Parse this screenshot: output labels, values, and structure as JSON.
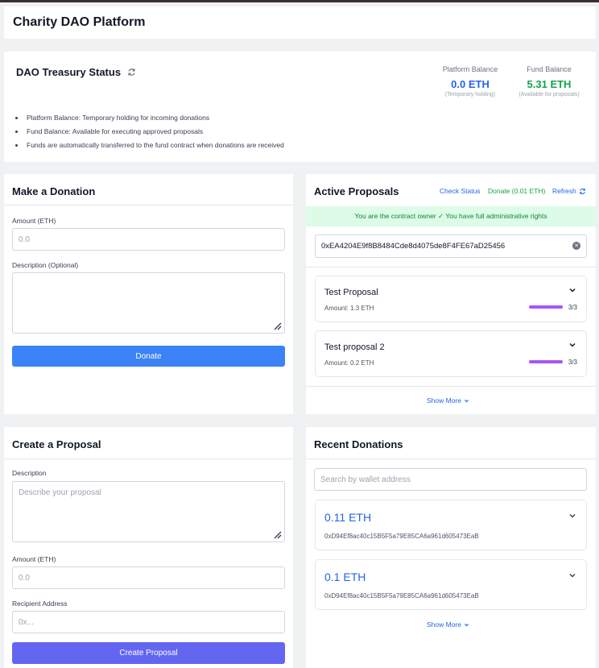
{
  "app": {
    "title": "Charity DAO Platform"
  },
  "treasury": {
    "title": "DAO Treasury Status",
    "platform": {
      "label": "Platform Balance",
      "value": "0.0 ETH",
      "note": "(Temporary holding)"
    },
    "fund": {
      "label": "Fund Balance",
      "value": "5.31 ETH",
      "note": "(Available for proposals)"
    },
    "bullets": [
      "Platform Balance: Temporary holding for incoming donations",
      "Fund Balance: Available for executing approved proposals",
      "Funds are automatically transferred to the fund contract when donations are received"
    ],
    "colors": {
      "platform": "#2563eb",
      "fund": "#16a34a"
    }
  },
  "donation": {
    "title": "Make a Donation",
    "amount_label": "Amount (ETH)",
    "amount_placeholder": "0.0",
    "description_label": "Description (Optional)",
    "button": "Donate",
    "button_color": "#3b82f6"
  },
  "proposals": {
    "title": "Active Proposals",
    "links": {
      "check": "Check Status",
      "donate": "Donate (0.01 ETH)",
      "refresh": "Refresh"
    },
    "owner_message": "You are the contract owner ✓ You have full administrative rights",
    "address_value": "0xEA4204E9f8B8484Cde8d4075de8F4FE67aD25456",
    "items": [
      {
        "title": "Test Proposal",
        "amount": "Amount: 1.3 ETH",
        "votes": "3/3",
        "progress": 1.0
      },
      {
        "title": "Test proposal 2",
        "amount": "Amount: 0.2 ETH",
        "votes": "3/3",
        "progress": 1.0
      }
    ],
    "show_more": "Show More"
  },
  "create": {
    "title": "Create a Proposal",
    "description_label": "Description",
    "description_placeholder": "Describe your proposal",
    "amount_label": "Amount (ETH)",
    "amount_placeholder": "0.0",
    "recipient_label": "Recipient Address",
    "recipient_placeholder": "0x...",
    "button": "Create Proposal",
    "button_color": "#6366f1"
  },
  "recent": {
    "title": "Recent Donations",
    "search_placeholder": "Search by wallet address",
    "items": [
      {
        "amount": "0.11 ETH",
        "wallet": "0xD94Ef8ac40c15B5F5a79E85CA6a961d605473EaB"
      },
      {
        "amount": "0.1 ETH",
        "wallet": "0xD94Ef8ac40c15B5F5a79E85CA6a961d605473EaB"
      }
    ],
    "show_more": "Show More"
  }
}
